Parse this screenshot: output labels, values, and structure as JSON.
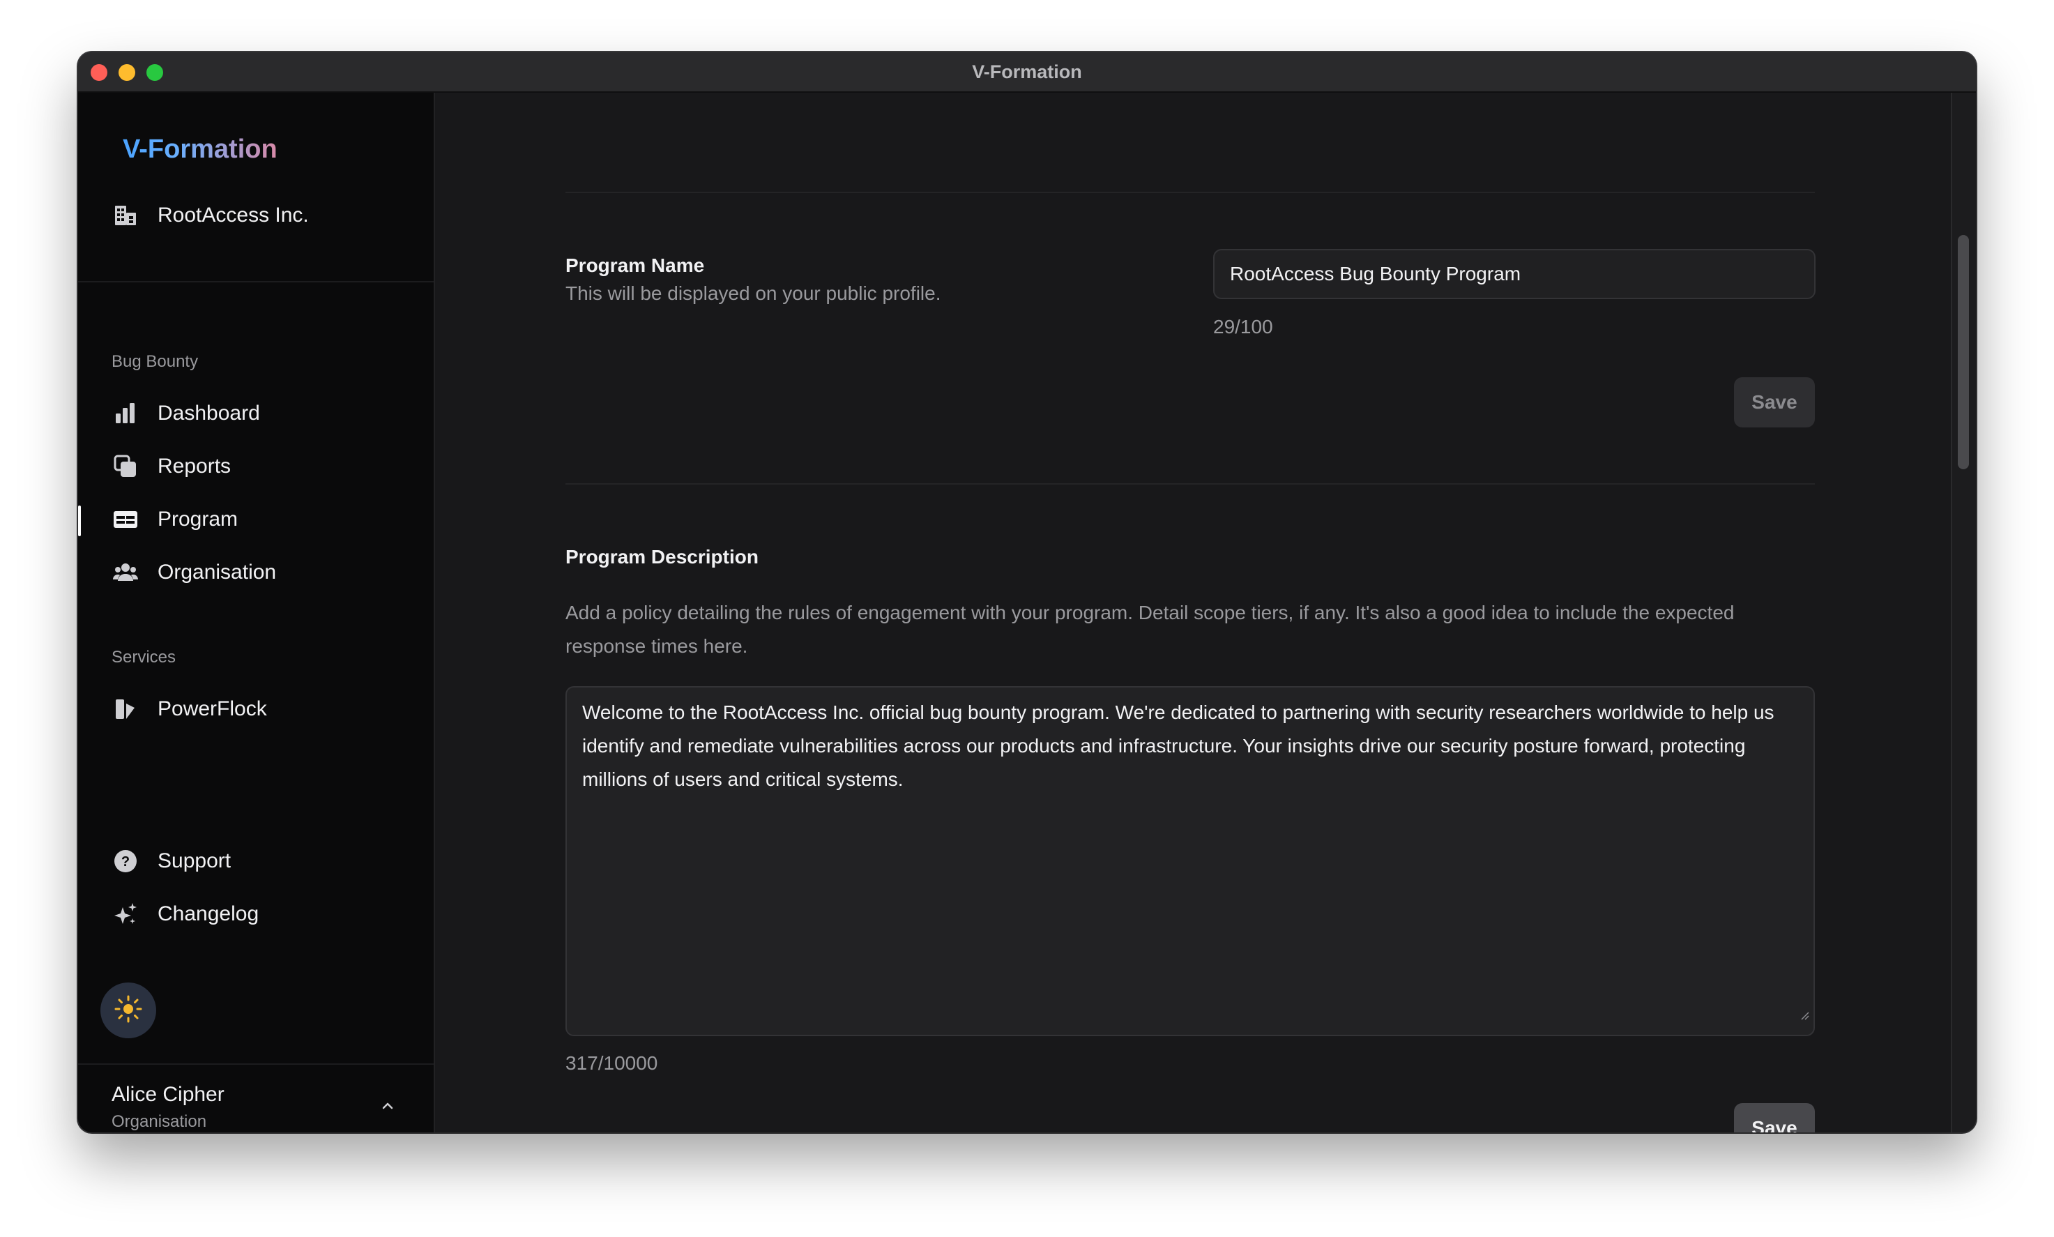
{
  "window": {
    "title": "V-Formation"
  },
  "sidebar": {
    "brand": "V-Formation",
    "org_name": "RootAccess Inc.",
    "sections": [
      {
        "label": "Bug Bounty"
      },
      {
        "label": "Services"
      }
    ],
    "items": [
      {
        "label": "Dashboard",
        "icon": "bar-chart-icon"
      },
      {
        "label": "Reports",
        "icon": "copy-icon"
      },
      {
        "label": "Program",
        "icon": "card-icon",
        "active": true
      },
      {
        "label": "Organisation",
        "icon": "users-icon"
      },
      {
        "label": "PowerFlock",
        "icon": "powerflock-icon"
      },
      {
        "label": "Support",
        "icon": "help-circle-icon"
      },
      {
        "label": "Changelog",
        "icon": "sparkles-icon"
      }
    ],
    "user": {
      "name": "Alice Cipher",
      "role": "Organisation"
    }
  },
  "program_name": {
    "title": "Program Name",
    "help": "This will be displayed on your public profile.",
    "value": "RootAccess Bug Bounty Program",
    "counter": "29/100",
    "save_label": "Save"
  },
  "program_description": {
    "title": "Program Description",
    "help": "Add a policy detailing the rules of engagement with your program. Detail scope tiers, if any. It's also a good idea to include the expected response times here.",
    "value": "Welcome to the RootAccess Inc. official bug bounty program. We're dedicated to partnering with security researchers worldwide to help us identify and remediate vulnerabilities across our products and infrastructure. Your insights drive our security posture forward, protecting millions of users and critical systems.",
    "counter": "317/10000",
    "save_label": "Save"
  },
  "colors": {
    "accent_brand_start": "#4aa3ff",
    "accent_brand_end": "#d98aa8",
    "theme_sun": "#f5b82e"
  }
}
